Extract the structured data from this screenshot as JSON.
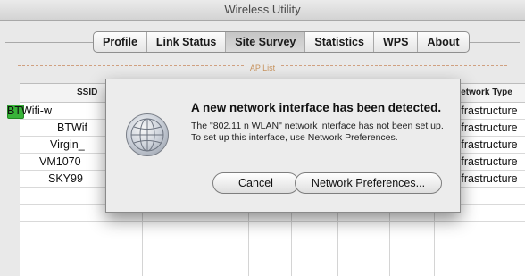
{
  "window": {
    "title": "Wireless Utility"
  },
  "tabs": [
    {
      "label": "Profile",
      "active": false
    },
    {
      "label": "Link Status",
      "active": false
    },
    {
      "label": "Site Survey",
      "active": true
    },
    {
      "label": "Statistics",
      "active": false
    },
    {
      "label": "WPS",
      "active": false
    },
    {
      "label": "About",
      "active": false
    }
  ],
  "ap_list": {
    "label": "AP List",
    "columns": {
      "ssid": "SSID",
      "network_type": "Network Type"
    },
    "rows": [
      {
        "ssid": "BTWifi-w",
        "network_type": "Infrastructure",
        "connected": true
      },
      {
        "ssid": "BTWif",
        "network_type": "Infrastructure",
        "connected": false
      },
      {
        "ssid": "Virgin_",
        "network_type": "Infrastructure",
        "connected": false
      },
      {
        "ssid": "VM1070",
        "network_type": "Infrastructure",
        "connected": false
      },
      {
        "ssid": "SKY99",
        "network_type": "Infrastructure",
        "connected": false
      }
    ]
  },
  "alert": {
    "title": "A new network interface has been detected.",
    "message": "The \"802.11 n WLAN\" network interface has not been set up. To set up this interface, use Network Preferences.",
    "buttons": {
      "cancel": "Cancel",
      "network_preferences": "Network Preferences..."
    }
  }
}
